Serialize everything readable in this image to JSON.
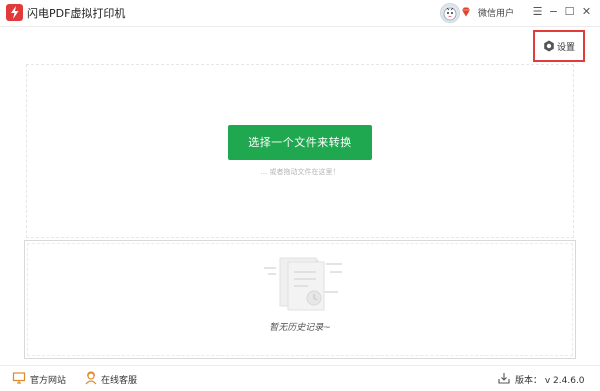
{
  "titlebar": {
    "app_title": "闪电PDF虚拟打印机",
    "user_name": "微信用户",
    "menu_glyph": "☰",
    "minimize_glyph": "−",
    "maximize_glyph": "☐",
    "close_glyph": "✕"
  },
  "toolbar": {
    "settings_label": "设置"
  },
  "main": {
    "select_file_label": "选择一个文件来转换",
    "drag_hint": "... 或者拖动文件在这里！"
  },
  "history": {
    "empty_text": "暂无历史记录~"
  },
  "footer": {
    "official_site_label": "官方网站",
    "online_support_label": "在线客服",
    "version_text": "版本： v 2.4.6.0"
  },
  "colors": {
    "accent_green": "#1fa84f",
    "brand_red": "#e03a3a",
    "highlight_border": "#e23b3b"
  },
  "icons": {
    "logo": "pdf-lightning-logo",
    "user": "avatar-icon",
    "vip": "vip-diamond-icon",
    "settings": "gear-icon",
    "site": "monitor-icon",
    "support": "headset-person-icon",
    "version": "download-icon"
  }
}
